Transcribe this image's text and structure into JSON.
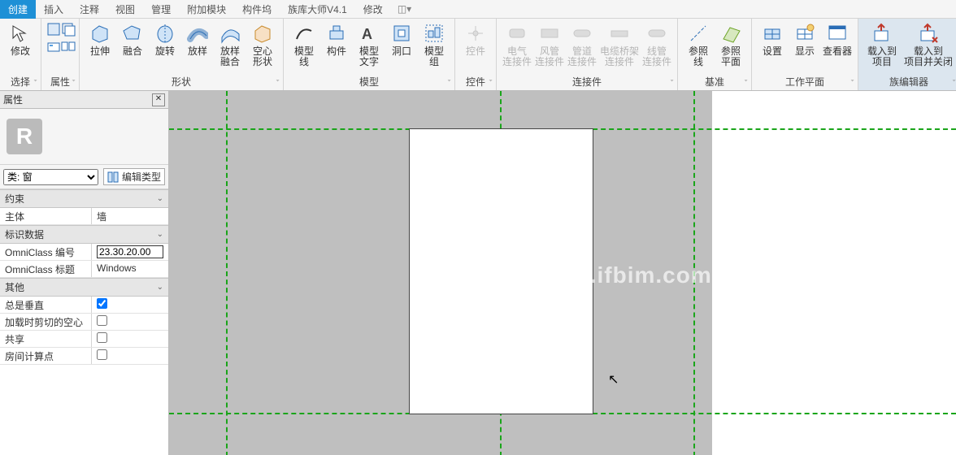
{
  "tabs": [
    "创建",
    "插入",
    "注释",
    "视图",
    "管理",
    "附加模块",
    "构件坞",
    "族库大师V4.1",
    "修改"
  ],
  "active_tab": 0,
  "groups": {
    "select": {
      "label": "选择",
      "items": [
        {
          "name": "修改",
          "label": "修改"
        }
      ]
    },
    "prop": {
      "label": "属性"
    },
    "shape": {
      "label": "形状",
      "items": [
        "拉伸",
        "融合",
        "旋转",
        "放样",
        "放样\n融合",
        "空心\n形状"
      ]
    },
    "model": {
      "label": "模型",
      "items": [
        "模型\n线",
        "构件",
        "模型\n文字",
        "洞口",
        "模型\n组"
      ]
    },
    "ctrl": {
      "label": "控件",
      "items": [
        "控件"
      ]
    },
    "conn": {
      "label": "连接件",
      "items": [
        "电气\n连接件",
        "风管\n连接件",
        "管道\n连接件",
        "电缆桥架\n连接件",
        "线管\n连接件"
      ]
    },
    "datum": {
      "label": "基准",
      "items": [
        "参照\n线",
        "参照\n平面"
      ]
    },
    "wplane": {
      "label": "工作平面",
      "items": [
        "设置",
        "显示",
        "查看器"
      ]
    },
    "famed": {
      "label": "族编辑器",
      "items": [
        "载入到\n项目",
        "载入到\n项目并关闭"
      ]
    }
  },
  "edit_type": "编辑类型",
  "panel": {
    "title": "属性",
    "category_label": "类: 窗",
    "sections": [
      {
        "cat": "约束",
        "rows": [
          {
            "n": "主体",
            "v": "墙",
            "t": "text"
          }
        ]
      },
      {
        "cat": "标识数据",
        "rows": [
          {
            "n": "OmniClass 编号",
            "v": "23.30.20.00",
            "t": "input"
          },
          {
            "n": "OmniClass 标题",
            "v": "Windows",
            "t": "text"
          }
        ]
      },
      {
        "cat": "其他",
        "rows": [
          {
            "n": "总是垂直",
            "v": true,
            "t": "check"
          },
          {
            "n": "加载时剪切的空心",
            "v": false,
            "t": "check"
          },
          {
            "n": "共享",
            "v": false,
            "t": "check"
          },
          {
            "n": "房间计算点",
            "v": false,
            "t": "check"
          }
        ]
      }
    ]
  },
  "watermark": "BIM教程网|www.ifbim.com"
}
